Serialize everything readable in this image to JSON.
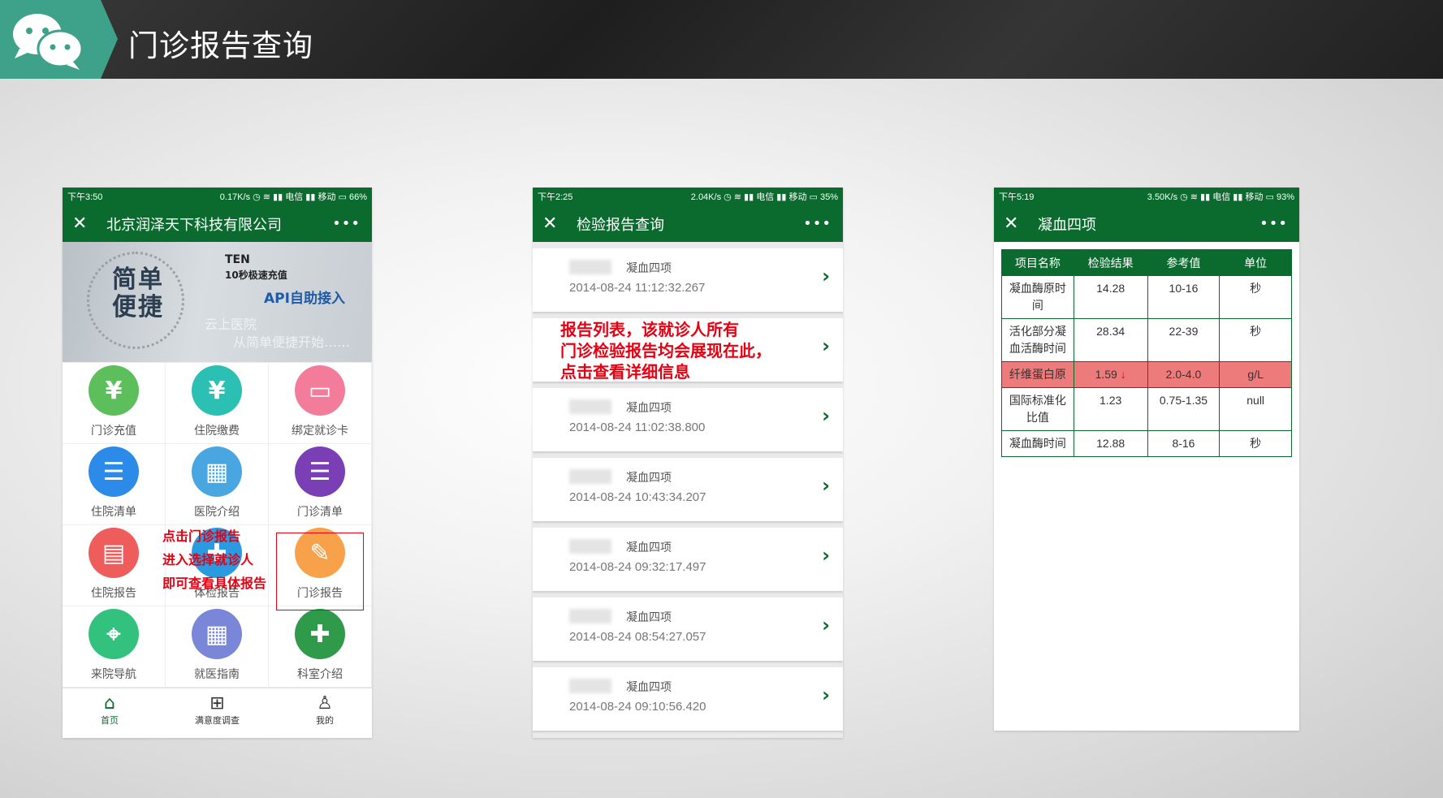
{
  "header": {
    "title": "门诊报告查询"
  },
  "phone1": {
    "status": {
      "time": "下午3:50",
      "speed": "0.17K/s",
      "carrier": "电信",
      "carrier2": "移动",
      "battery": "66%"
    },
    "nav": {
      "close": "✕",
      "title": "北京润泽天下科技有限公司",
      "more": "•••"
    },
    "banner": {
      "big": "简单便捷",
      "ten": "TEN",
      "ten_sub": "10秒极速充值",
      "api": "API自助接入",
      "cloud": "云上医院",
      "slogan": "从简单便捷开始……"
    },
    "grid": [
      {
        "label": "门诊充值",
        "icon": "¥",
        "color": "#5cbf5c"
      },
      {
        "label": "住院缴费",
        "icon": "¥",
        "color": "#2cbfb3"
      },
      {
        "label": "绑定就诊卡",
        "icon": "▭",
        "color": "#f27c9a"
      },
      {
        "label": "住院清单",
        "icon": "☰",
        "color": "#2c8ae8"
      },
      {
        "label": "医院介绍",
        "icon": "▦",
        "color": "#4aa6e0"
      },
      {
        "label": "门诊清单",
        "icon": "☰",
        "color": "#7b3fb5"
      },
      {
        "label": "住院报告",
        "icon": "▤",
        "color": "#ef5c5c"
      },
      {
        "label": "体检报告",
        "icon": "✚",
        "color": "#2a9be0"
      },
      {
        "label": "门诊报告",
        "icon": "✎",
        "color": "#f7a24a"
      },
      {
        "label": "来院导航",
        "icon": "⌖",
        "color": "#32c27e"
      },
      {
        "label": "就医指南",
        "icon": "▦",
        "color": "#7a86d8"
      },
      {
        "label": "科室介绍",
        "icon": "✚",
        "color": "#2e9a4a"
      }
    ],
    "tabs": [
      {
        "label": "首页",
        "icon": "⌂"
      },
      {
        "label": "满意度调查",
        "icon": "⊞"
      },
      {
        "label": "我的",
        "icon": "♙"
      }
    ],
    "annotation": [
      "点击门诊报告",
      "进入选择就诊人",
      "即可查看具体报告"
    ]
  },
  "phone2": {
    "status": {
      "time": "下午2:25",
      "speed": "2.04K/s",
      "carrier": "电信",
      "carrier2": "移动",
      "battery": "35%"
    },
    "nav": {
      "close": "✕",
      "title": "检验报告查询",
      "more": "•••"
    },
    "items": [
      {
        "type": "凝血四项",
        "date": "2014-08-24 11:12:32.267"
      },
      {
        "type": "",
        "date": ""
      },
      {
        "type": "凝血四项",
        "date": "2014-08-24 11:02:38.800"
      },
      {
        "type": "凝血四项",
        "date": "2014-08-24 10:43:34.207"
      },
      {
        "type": "凝血四项",
        "date": "2014-08-24 09:32:17.497"
      },
      {
        "type": "凝血四项",
        "date": "2014-08-24 08:54:27.057"
      },
      {
        "type": "凝血四项",
        "date": "2014-08-24 09:10:56.420"
      }
    ],
    "arrow": "›",
    "annotation": [
      "报告列表，该就诊人所有",
      "门诊检验报告均会展现在此，",
      "点击查看详细信息"
    ]
  },
  "phone3": {
    "status": {
      "time": "下午5:19",
      "speed": "3.50K/s",
      "carrier": "电信",
      "carrier2": "移动",
      "battery": "93%"
    },
    "nav": {
      "close": "✕",
      "title": "凝血四项",
      "more": "•••"
    },
    "table": {
      "headers": [
        "项目名称",
        "检验结果",
        "参考值",
        "单位"
      ],
      "rows": [
        {
          "name": "凝血酶原时间",
          "result": "14.28",
          "ref": "10-16",
          "unit": "秒"
        },
        {
          "name": "活化部分凝血活酶时间",
          "result": "28.34",
          "ref": "22-39",
          "unit": "秒"
        },
        {
          "name": "纤维蛋白原",
          "result": "1.59",
          "flag": "↓",
          "ref": "2.0-4.0",
          "unit": "g/L"
        },
        {
          "name": "国际标准化比值",
          "result": "1.23",
          "ref": "0.75-1.35",
          "unit": "null"
        },
        {
          "name": "凝血酶时间",
          "result": "12.88",
          "ref": "8-16",
          "unit": "秒"
        }
      ]
    }
  }
}
